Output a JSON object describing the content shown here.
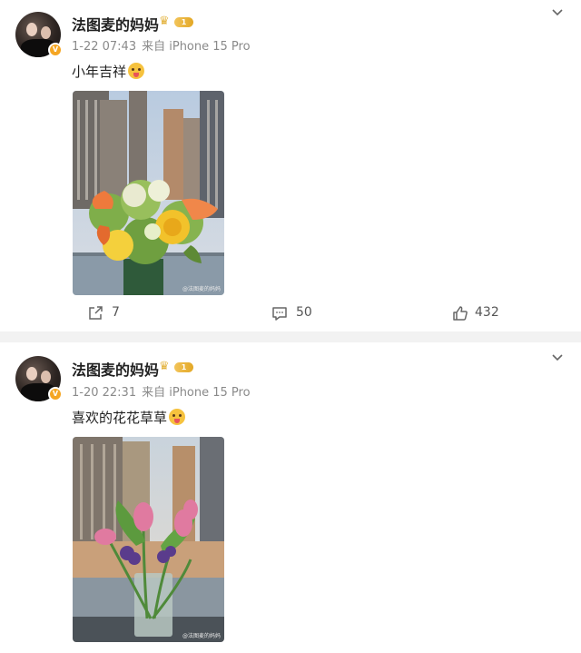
{
  "posts": [
    {
      "author": "法图麦的妈妈",
      "vip_level": "1",
      "time": "1-22 07:43",
      "source": "来自 iPhone 15 Pro",
      "text": "小年吉祥",
      "watermark": "@法图麦的妈妈",
      "reposts": "7",
      "comments": "50",
      "likes": "432"
    },
    {
      "author": "法图麦的妈妈",
      "vip_level": "1",
      "time": "1-20 22:31",
      "source": "来自 iPhone 15 Pro",
      "text": "喜欢的花花草草",
      "watermark": "@法图麦的妈妈"
    }
  ],
  "icons": {
    "verified": "verified-badge-icon",
    "vip": "crown-icon",
    "more": "chevron-down-icon",
    "repost": "repost-icon",
    "comment": "comment-icon",
    "like": "thumbs-up-icon"
  },
  "colors": {
    "badge": "#f5a623",
    "vip_gold": "#e3b23c",
    "meta_gray": "#8a8a8a",
    "divider": "#f2f2f2"
  }
}
